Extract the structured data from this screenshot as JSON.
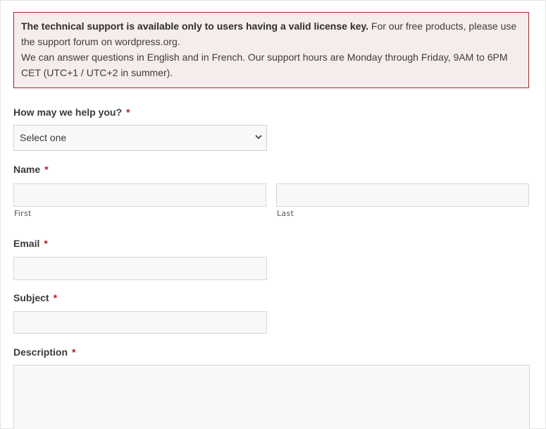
{
  "notice": {
    "bold_text": "The technical support is available only to users having a valid license key.",
    "text_line1_rest": " For our free products, please use the support forum on wordpress.org.",
    "text_line2": "We can answer questions in English and in French. Our support hours are Monday through Friday, 9AM to 6PM CET (UTC+1 / UTC+2 in summer).",
    "border_color": "#a0282d",
    "background_color": "#f7ecec"
  },
  "form": {
    "required_marker": "*",
    "help": {
      "label": "How may we help you?",
      "selected_option": "Select one",
      "icon": "chevron-down-icon"
    },
    "name": {
      "label": "Name",
      "first_sublabel": "First",
      "last_sublabel": "Last",
      "first_value": "",
      "last_value": ""
    },
    "email": {
      "label": "Email",
      "value": ""
    },
    "subject": {
      "label": "Subject",
      "value": ""
    },
    "description": {
      "label": "Description",
      "value": ""
    }
  }
}
